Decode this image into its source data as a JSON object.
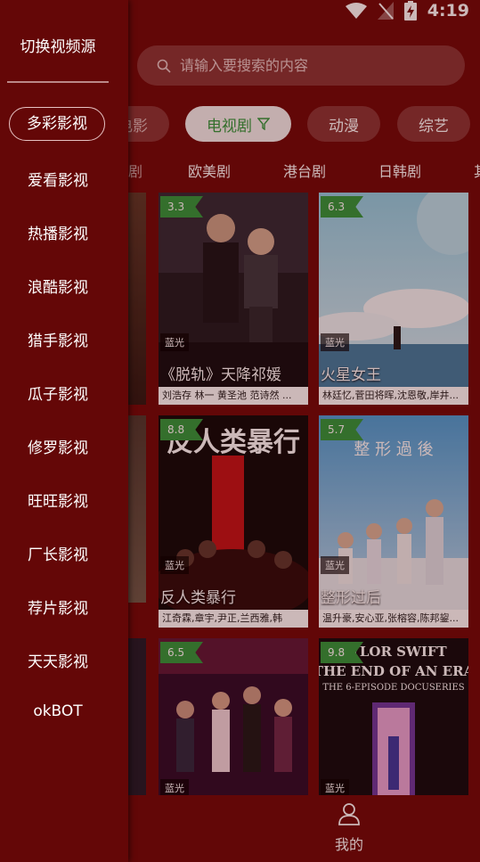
{
  "status_bar": {
    "time": "4:19",
    "icons": [
      "wifi-icon",
      "no-signal-icon",
      "battery-charging-icon"
    ]
  },
  "search": {
    "placeholder": "请输入要搜索的内容"
  },
  "category_tabs": [
    {
      "label": "电影",
      "active": false
    },
    {
      "label": "电视剧",
      "active": true
    },
    {
      "label": "动漫",
      "active": false
    },
    {
      "label": "综艺",
      "active": false
    }
  ],
  "sub_tabs": [
    "剧",
    "欧美剧",
    "港台剧",
    "日韩剧",
    "其"
  ],
  "cards": [
    {
      "rating": "3.3",
      "quality": "蓝光",
      "title": "《脱轨》天降祁媛",
      "cast": "刘浩存 林一 黄圣池 范诗然 ..."
    },
    {
      "rating": "6.3",
      "quality": "蓝光",
      "title": "火星女王",
      "cast": "林廷忆,菅田将晖,沈恩敬,岸井..."
    },
    {
      "rating": "8.8",
      "quality": "蓝光",
      "title": "反人类暴行",
      "cast": "江奇霖,章宇,尹正,兰西雅,韩"
    },
    {
      "rating": "5.7",
      "quality": "蓝光",
      "title": "整形过后",
      "cast": "温升豪,安心亚,张榕容,陈邦鋆..."
    },
    {
      "rating": "6.5",
      "quality": "蓝光",
      "title": "",
      "cast": ""
    },
    {
      "rating": "9.8",
      "quality": "蓝光",
      "title": "",
      "cast": ""
    }
  ],
  "poster_text": {
    "card3": "反人类暴行",
    "card4": "整 形 過 後",
    "card6_line1": "AYLOR SWIFT",
    "card6_line2": "THE END OF AN ERA",
    "card6_line3": "THE 6-EPISODE DOCUSERIES"
  },
  "bottom_nav": {
    "mine_label": "我的"
  },
  "drawer": {
    "title": "切换视频源",
    "sources": [
      "多彩影视",
      "爱看影视",
      "热播影视",
      "浪酷影视",
      "猎手影视",
      "瓜子影视",
      "修罗影视",
      "旺旺影视",
      "厂长影视",
      "荐片影视",
      "天天影视",
      "okBOT"
    ],
    "active_index": 0
  },
  "colors": {
    "background": "#6e0a0a",
    "drawer": "#640707",
    "accent_green": "#2f9a3e"
  }
}
